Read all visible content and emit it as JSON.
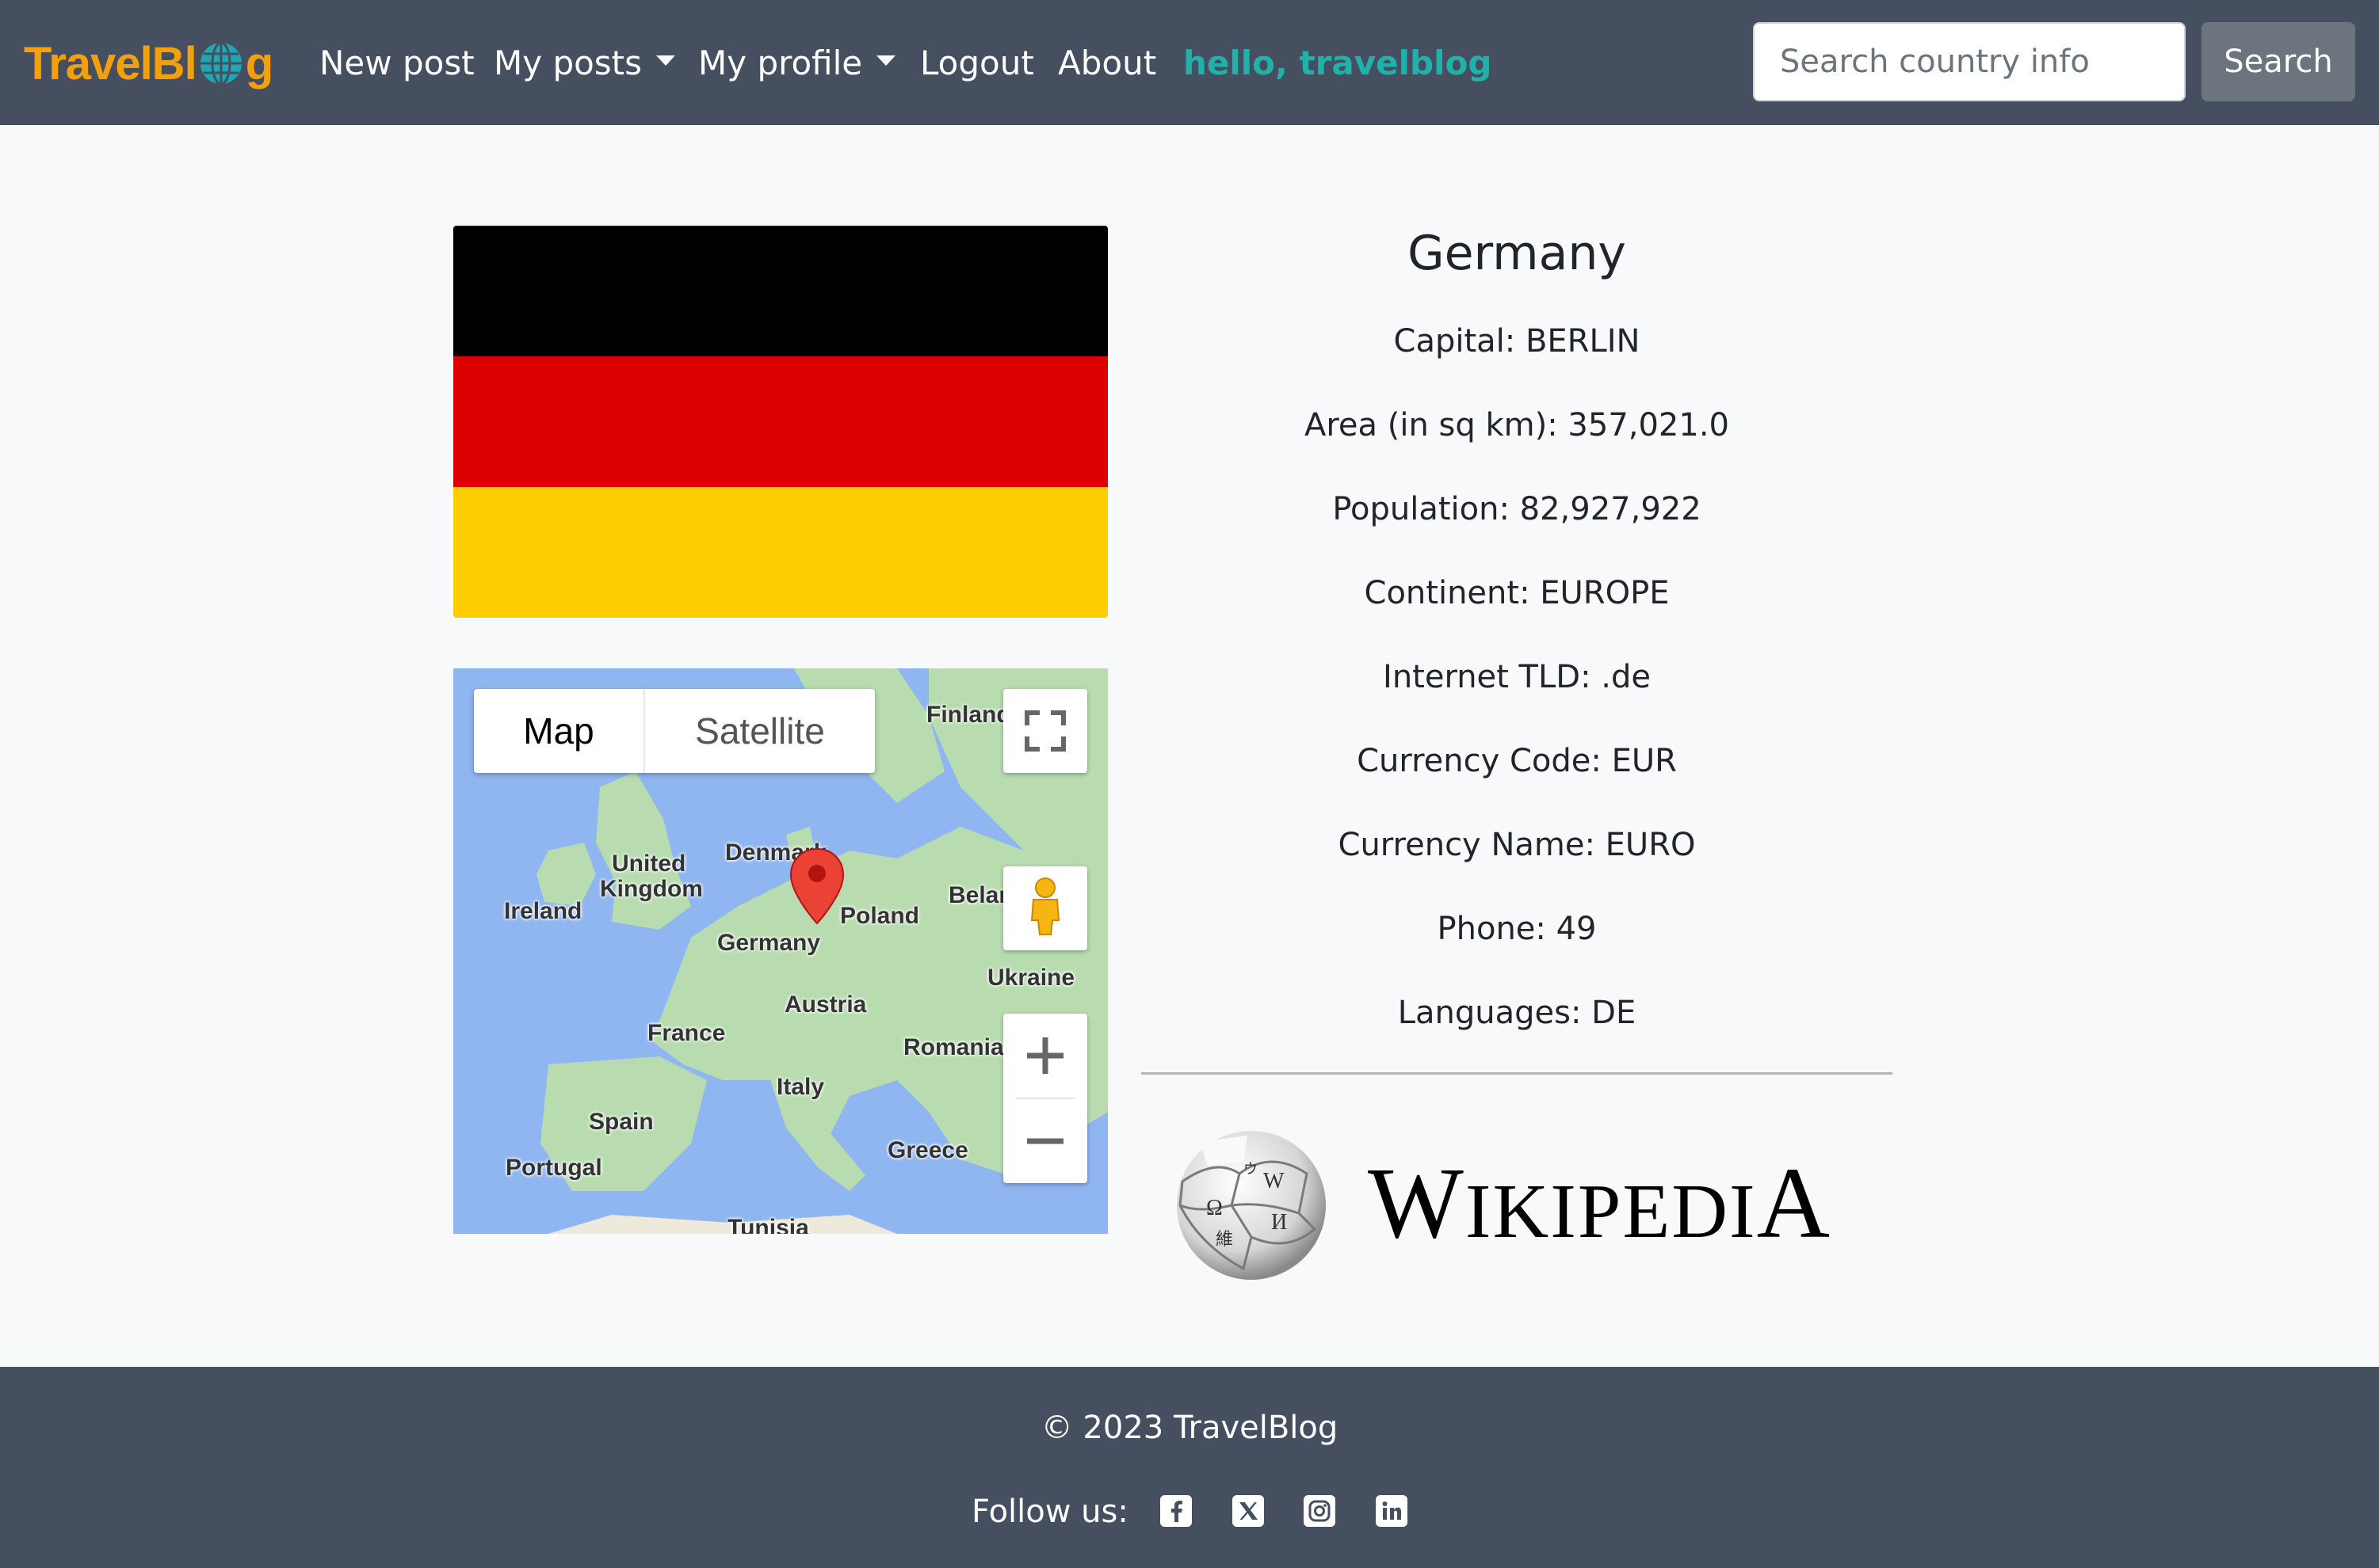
{
  "navbar": {
    "brand_left": "TravelBl",
    "brand_right": "g",
    "items": [
      {
        "label": "New post"
      },
      {
        "label": "My posts"
      },
      {
        "label": "My profile"
      },
      {
        "label": "Logout"
      },
      {
        "label": "About"
      },
      {
        "label": "hello, travelblog"
      }
    ],
    "search_placeholder": "Search country info",
    "search_button": "Search"
  },
  "flag": {
    "colors": [
      "#000000",
      "#dd0000",
      "#ffce00"
    ]
  },
  "map": {
    "map_label": "Map",
    "satellite_label": "Satellite",
    "labels": [
      "Finland",
      "Denmark",
      "United",
      "Kingdom",
      "Ireland",
      "Belarus",
      "Poland",
      "Germany",
      "Ukraine",
      "Austria",
      "France",
      "Romania",
      "Italy",
      "Spain",
      "Greece",
      "Portugal",
      "Tunisia"
    ],
    "marker_color": "#ea4335"
  },
  "country": {
    "name": "Germany",
    "capital": "Capital: BERLIN",
    "area": "Area (in sq km): 357,021.0",
    "population": "Population: 82,927,922",
    "continent": "Continent: EUROPE",
    "tld": "Internet TLD: .de",
    "currency_code": "Currency Code: EUR",
    "currency_name": "Currency Name: EURO",
    "phone": "Phone: 49",
    "languages": "Languages: DE"
  },
  "wikipedia": {
    "w": "W",
    "ikipedi": "IKIPEDI",
    "a": "A"
  },
  "footer": {
    "copyright": "© 2023 TravelBlog",
    "follow": "Follow us:",
    "social": [
      "facebook-icon",
      "x-twitter-icon",
      "instagram-icon",
      "linkedin-icon"
    ]
  }
}
